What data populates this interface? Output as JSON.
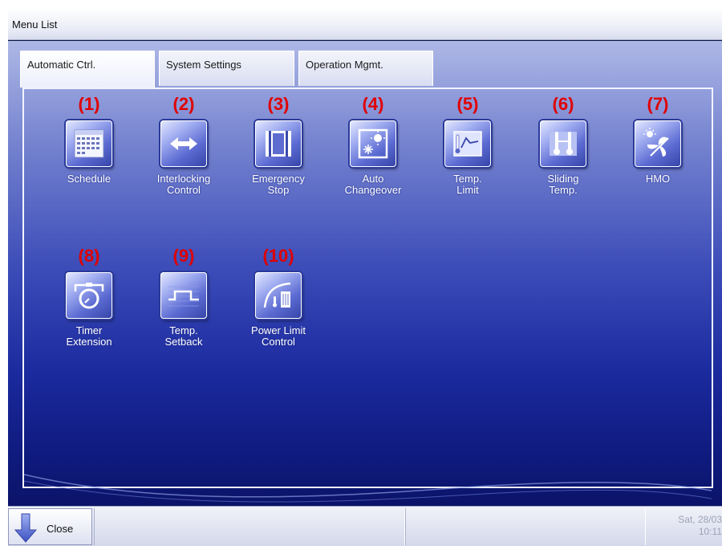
{
  "window": {
    "title": "Menu List"
  },
  "tabs": [
    {
      "label": "Automatic Ctrl.",
      "active": true
    },
    {
      "label": "System Settings",
      "active": false
    },
    {
      "label": "Operation Mgmt.",
      "active": false
    }
  ],
  "menu_items": [
    {
      "number": "(1)",
      "label_line1": "Schedule",
      "label_line2": "",
      "icon": "calendar-icon"
    },
    {
      "number": "(2)",
      "label_line1": "Interlocking",
      "label_line2": "Control",
      "icon": "double-arrow-icon"
    },
    {
      "number": "(3)",
      "label_line1": "Emergency",
      "label_line2": "Stop",
      "icon": "emergency-stop-icon"
    },
    {
      "number": "(4)",
      "label_line1": "Auto",
      "label_line2": "Changeover",
      "icon": "auto-changeover-icon"
    },
    {
      "number": "(5)",
      "label_line1": "Temp.",
      "label_line2": "Limit",
      "icon": "temp-limit-icon"
    },
    {
      "number": "(6)",
      "label_line1": "Sliding",
      "label_line2": "Temp.",
      "icon": "sliding-temp-icon"
    },
    {
      "number": "(7)",
      "label_line1": "HMO",
      "label_line2": "",
      "icon": "hmo-fan-icon"
    },
    {
      "number": "(8)",
      "label_line1": "Timer",
      "label_line2": "Extension",
      "icon": "stopwatch-icon"
    },
    {
      "number": "(9)",
      "label_line1": "Temp.",
      "label_line2": "Setback",
      "icon": "setback-icon"
    },
    {
      "number": "(10)",
      "label_line1": "Power Limit",
      "label_line2": "Control",
      "icon": "power-limit-icon"
    }
  ],
  "bottom_bar": {
    "close_label": "Close",
    "date": "Sat, 28/03",
    "time": "10:11"
  },
  "colors": {
    "annotation_red": "#e00000",
    "background_top": "#aeb8e6",
    "background_bottom": "#0a1364"
  }
}
